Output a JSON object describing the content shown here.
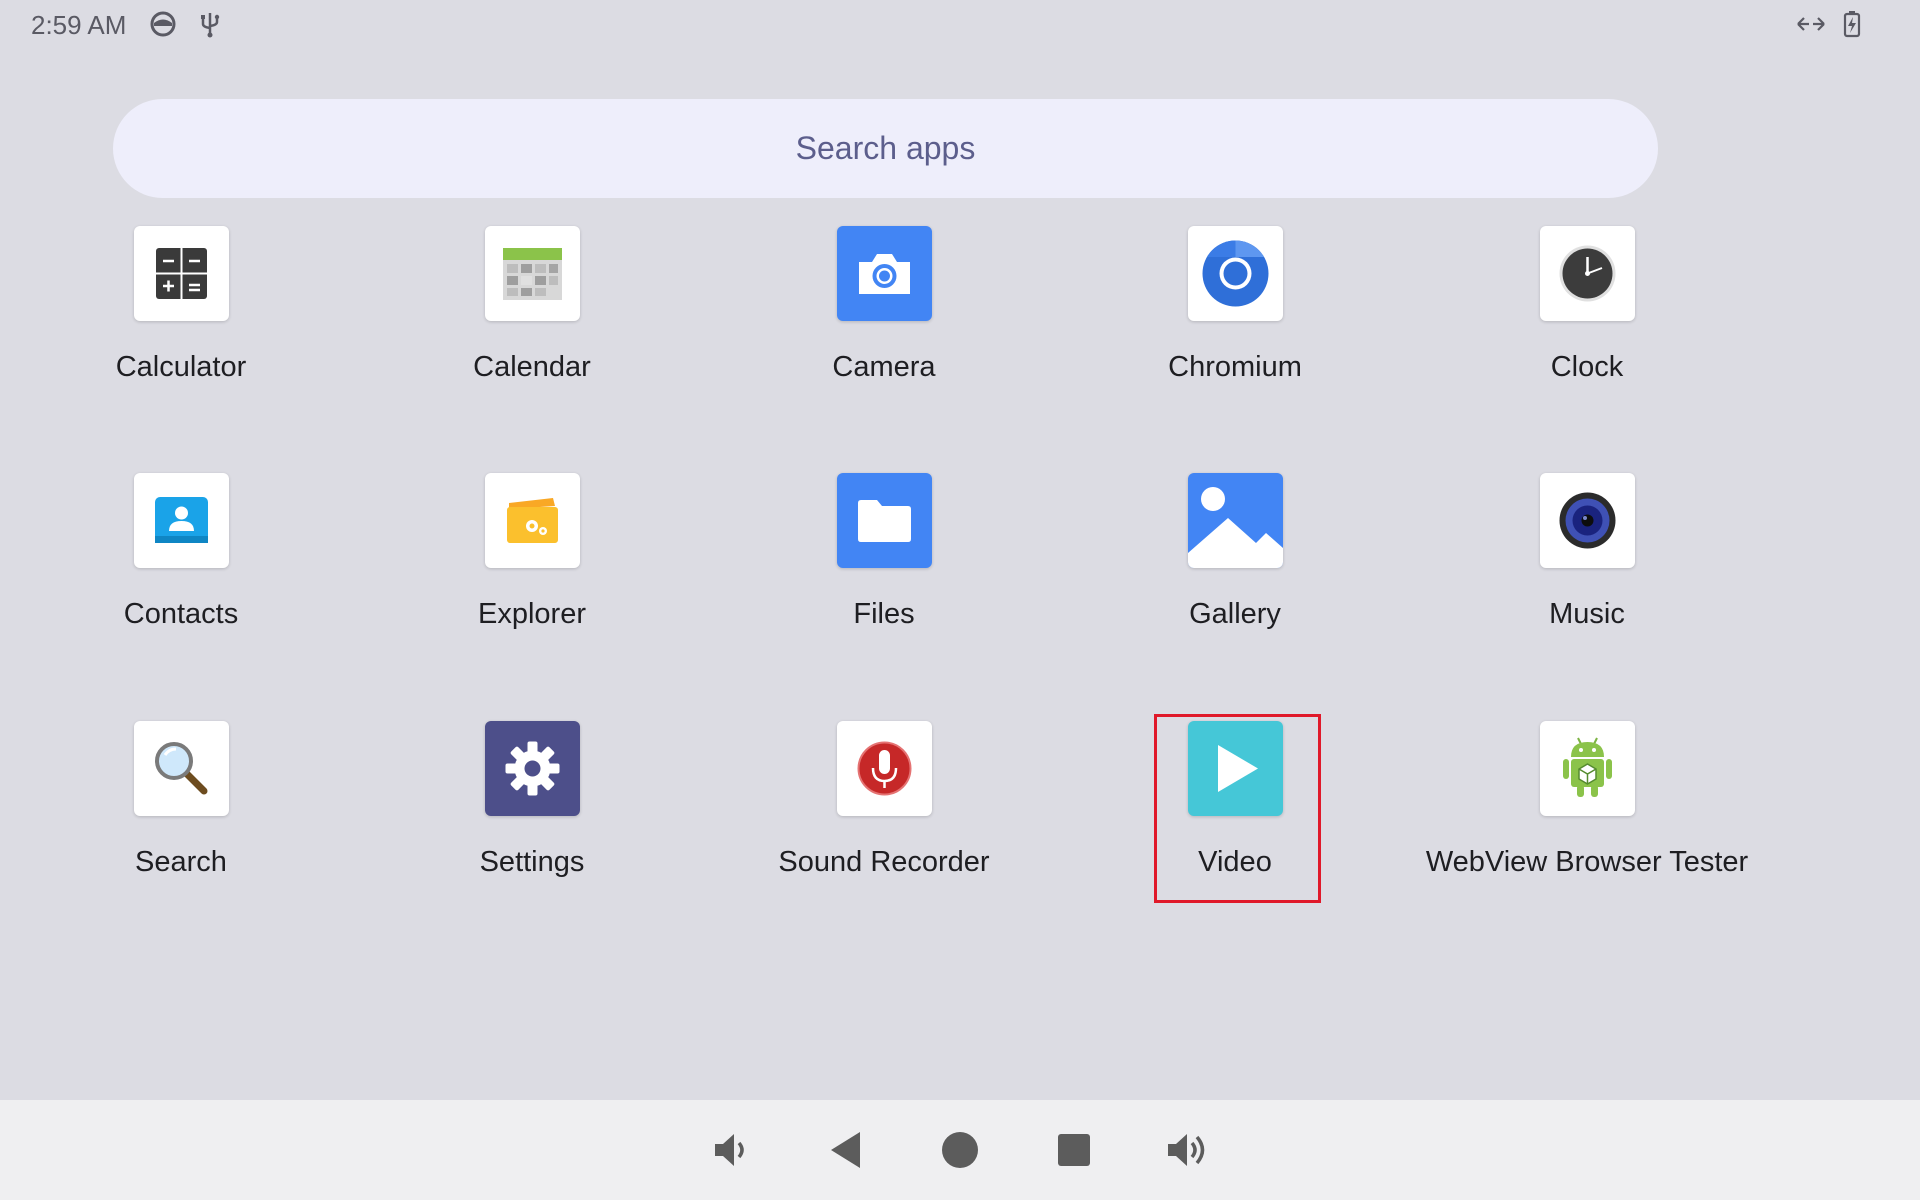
{
  "status_bar": {
    "time": "2:59 AM",
    "left_icons": [
      "data-saver-icon",
      "usb-icon"
    ],
    "right_icons": [
      "network-arrows-icon",
      "battery-charging-icon"
    ]
  },
  "search": {
    "placeholder": "Search apps"
  },
  "apps": [
    {
      "label": "Calculator",
      "icon": "calculator-icon"
    },
    {
      "label": "Calendar",
      "icon": "calendar-icon"
    },
    {
      "label": "Camera",
      "icon": "camera-icon"
    },
    {
      "label": "Chromium",
      "icon": "chromium-icon"
    },
    {
      "label": "Clock",
      "icon": "clock-icon"
    },
    {
      "label": "Contacts",
      "icon": "contacts-icon"
    },
    {
      "label": "Explorer",
      "icon": "explorer-icon"
    },
    {
      "label": "Files",
      "icon": "files-icon"
    },
    {
      "label": "Gallery",
      "icon": "gallery-icon"
    },
    {
      "label": "Music",
      "icon": "music-icon"
    },
    {
      "label": "Search",
      "icon": "search-icon"
    },
    {
      "label": "Settings",
      "icon": "settings-icon"
    },
    {
      "label": "Sound Recorder",
      "icon": "microphone-icon"
    },
    {
      "label": "Video",
      "icon": "video-play-icon"
    },
    {
      "label": "WebView Browser Tester",
      "icon": "android-robot-icon"
    }
  ],
  "highlighted_app": "Video",
  "nav_bar": {
    "buttons": [
      "volume-down-icon",
      "back-icon",
      "home-icon",
      "recents-icon",
      "volume-up-icon"
    ]
  },
  "colors": {
    "background": "#dcdce3",
    "search_bar": "#eeeefb",
    "search_text": "#5c5e8c",
    "highlight": "#e0192a",
    "nav_bar": "#efeff1"
  }
}
